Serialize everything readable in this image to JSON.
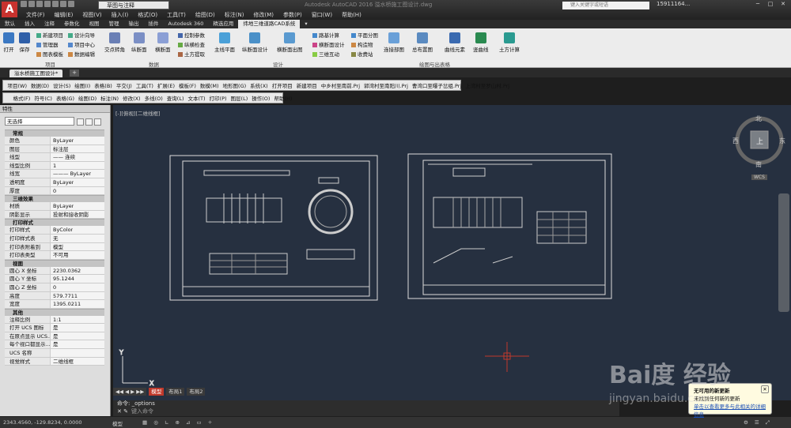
{
  "title_bar": {
    "logo": "A",
    "workspace": "草图与注释",
    "app_title": "Autodesk AutoCAD 2016    溢水桥施工图设计.dwg",
    "search_placeholder": "键入关键字或短语",
    "user": "15911164...",
    "menu": [
      "文件(F)",
      "编辑(E)",
      "视图(V)",
      "插入(I)",
      "格式(O)",
      "工具(T)",
      "绘图(D)",
      "标注(N)",
      "修改(M)",
      "参数(P)",
      "窗口(W)",
      "帮助(H)"
    ]
  },
  "ribbon_tabs": [
    "默认",
    "插入",
    "注释",
    "参数化",
    "视图",
    "管理",
    "输出",
    "插件",
    "Autodesk 360",
    "精选应用",
    "纬地三维道路CAD系统"
  ],
  "ribbon_active_tab": "纬地三维道路CAD系统",
  "ribbon": {
    "big_buttons": [
      "打开",
      "保存",
      "交点转角",
      "纵断面",
      "横断面",
      "主线平面",
      "纵断面设计",
      "横断面出图",
      "连接部图",
      "总布置图",
      "曲线元素",
      "竖曲线",
      "土方计算"
    ],
    "small_buttons": {
      "project": [
        "新建项目",
        "管理器",
        "图表模板",
        "设计向导",
        "项目中心",
        "数据编辑"
      ],
      "data": [
        "控制参数",
        "纵横检查",
        "土方提取"
      ],
      "design": [
        "路基计算",
        "横断面设计",
        "三维互动",
        "平面分图",
        "构造物",
        "收费站"
      ]
    },
    "panel_titles": [
      "项目",
      "数据",
      "设计",
      "绘图与出表格"
    ]
  },
  "doc_tab": "溢水桥施工图设计*",
  "toolbar1": [
    "项目(W)",
    "数据(D)",
    "设计(S)",
    "绘图(I)",
    "表格(B)",
    "平交(J)",
    "工具(T)",
    "扩展(E)",
    "模板(F)",
    "数模(M)",
    "地形图(G)",
    "系统(X)",
    "打开项目",
    "新建项目",
    "中乡村至南前.Prj",
    "郭湾村至南阳川.Prj",
    "曹湾口至曝子岔组.Prj",
    "上湾村至罗山村.Prj"
  ],
  "toolbar2": [
    "格式(F)",
    "符号(C)",
    "表格(G)",
    "绘图(D)",
    "标注(N)",
    "修改(X)",
    "多线(O)",
    "查询(L)",
    "文本(T)",
    "打印(P)",
    "图层(L)",
    "操作(O)",
    "帮助(H)"
  ],
  "properties": {
    "title": "特性",
    "selection": "无选择",
    "sections": [
      {
        "name": "常规",
        "rows": [
          [
            "颜色",
            "ByLayer"
          ],
          [
            "图层",
            "标注层"
          ],
          [
            "线型",
            "—— 连续"
          ],
          [
            "线型比例",
            "1"
          ],
          [
            "线宽",
            "——— ByLayer"
          ],
          [
            "透明度",
            "ByLayer"
          ],
          [
            "厚度",
            "0"
          ]
        ]
      },
      {
        "name": "三维效果",
        "rows": [
          [
            "材质",
            "ByLayer"
          ],
          [
            "阴影显示",
            "投射和接收阴影"
          ]
        ]
      },
      {
        "name": "打印样式",
        "rows": [
          [
            "打印样式",
            "ByColor"
          ],
          [
            "打印样式表",
            "无"
          ],
          [
            "打印表附着到",
            "模型"
          ],
          [
            "打印表类型",
            "不可用"
          ]
        ]
      },
      {
        "name": "视图",
        "rows": [
          [
            "圆心 X 坐标",
            "2230.0362"
          ],
          [
            "圆心 Y 坐标",
            "95.1244"
          ],
          [
            "圆心 Z 坐标",
            "0"
          ],
          [
            "高度",
            "579.7711"
          ],
          [
            "宽度",
            "1395.0211"
          ]
        ]
      },
      {
        "name": "其他",
        "rows": [
          [
            "注释比例",
            "1:1"
          ],
          [
            "打开 UCS 图标",
            "是"
          ],
          [
            "在原点显示 UCS...",
            "是"
          ],
          [
            "每个视口都显示...",
            "是"
          ],
          [
            "UCS 名称",
            ""
          ],
          [
            "视觉样式",
            "二维线框"
          ]
        ]
      }
    ]
  },
  "viewport_label": "[-][俯视][二维线框]",
  "viewcube": {
    "north": "北",
    "south": "南",
    "east": "东",
    "west": "西",
    "top": "上",
    "wcs": "WCS"
  },
  "layout_tabs": [
    "模型",
    "布局1",
    "布局2"
  ],
  "command": {
    "history": "命令: _options",
    "prompt": "键入命令"
  },
  "status_coords": "2343.4560, -129.8234, 0.0000",
  "status_model": "模型",
  "notification": {
    "title": "无可用的新更新",
    "line": "未找到任何新的更新",
    "link": "单击以查看更多与此相关的详细信息"
  },
  "watermark": {
    "brand": "Bai度 经验",
    "url": "jingyan.baidu.com"
  },
  "colors": {
    "canvas": "#263040",
    "ribbon": "#ececec",
    "accent": "#c8322e"
  }
}
